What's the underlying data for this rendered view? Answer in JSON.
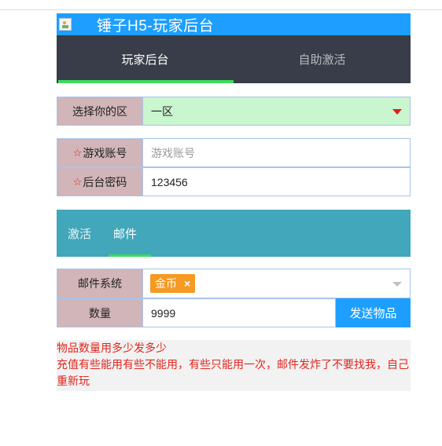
{
  "header": {
    "title": "锤子H5-玩家后台"
  },
  "main_tabs": [
    {
      "label": "玩家后台",
      "active": true
    },
    {
      "label": "自助激活",
      "active": false
    }
  ],
  "server": {
    "label": "选择你的区",
    "value": "一区"
  },
  "account": {
    "label": "游戏账号",
    "placeholder": "游戏账号",
    "value": ""
  },
  "password": {
    "label": "后台密码",
    "value": "123456"
  },
  "sub_tabs": [
    {
      "label": "激活",
      "active": false
    },
    {
      "label": "邮件",
      "active": true
    }
  ],
  "mail": {
    "label": "邮件系统",
    "selected_tag": "金币",
    "quantity_label": "数量",
    "quantity_value": "9999",
    "send_label": "发送物品"
  },
  "notice": {
    "line1": "物品数量用多少发多少",
    "line2": "充值有些能用有些不能用，有些只能用一次，邮件发炸了不要找我，自己重新玩"
  },
  "colors": {
    "header_bg": "#1e9fff",
    "tab_bar_bg": "#393d49",
    "tab_indicator": "#3ddc5c",
    "sub_tab_bg": "#42a7ba",
    "label_bg": "#d1b5b8",
    "server_field_bg": "#c9f5cf",
    "tag_bg": "#f59a23",
    "notice_text": "#e0261e"
  },
  "icons": {
    "header_image": "broken-image-icon",
    "server_dropdown": "caret-down-icon",
    "mail_dropdown": "caret-down-icon",
    "tag_remove": "close-icon",
    "required": "star-icon"
  }
}
